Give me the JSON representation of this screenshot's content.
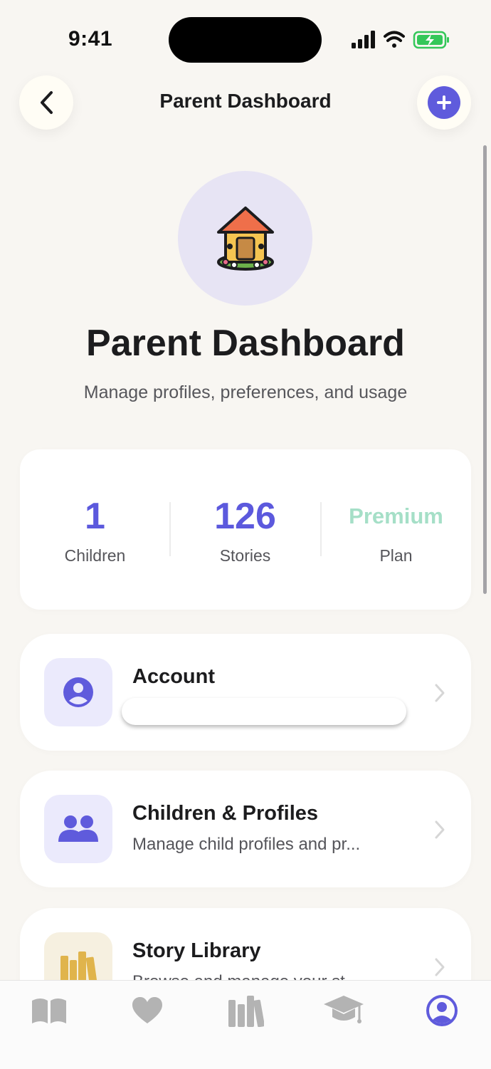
{
  "status_bar": {
    "time": "9:41"
  },
  "header": {
    "title": "Parent Dashboard"
  },
  "hero": {
    "title": "Parent Dashboard",
    "subtitle": "Manage profiles, preferences, and usage"
  },
  "stats": [
    {
      "value": "1",
      "label": "Children"
    },
    {
      "value": "126",
      "label": "Stories"
    },
    {
      "value": "Premium",
      "label": "Plan"
    }
  ],
  "menu": [
    {
      "title": "Account",
      "subtitle": ""
    },
    {
      "title": "Children & Profiles",
      "subtitle": "Manage child profiles and pr..."
    },
    {
      "title": "Story Library",
      "subtitle": "Browse and manage your st..."
    }
  ],
  "tabs": [
    {
      "icon": "book-icon",
      "active": false
    },
    {
      "icon": "heart-icon",
      "active": false
    },
    {
      "icon": "library-icon",
      "active": false
    },
    {
      "icon": "graduation-cap-icon",
      "active": false
    },
    {
      "icon": "profile-icon",
      "active": true
    }
  ],
  "colors": {
    "accent": "#5f5bdc",
    "premium": "#a5dfc7",
    "background": "#f8f6f2",
    "tab_inactive": "#b3b3b3"
  }
}
